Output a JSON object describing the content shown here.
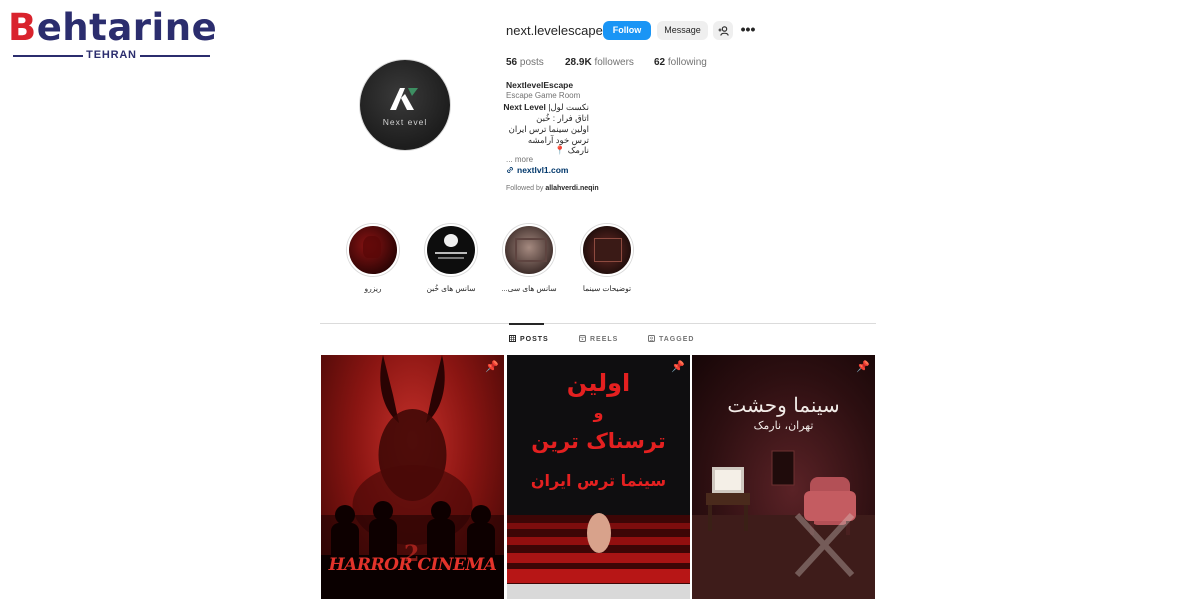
{
  "watermark": {
    "title_first": "B",
    "title_rest": "ehtarine",
    "subtitle": "TEHRAN"
  },
  "profile": {
    "username": "next.levelescape",
    "avatar_text": "Next  evel",
    "buttons": {
      "follow": "Follow",
      "message": "Message",
      "add_user_icon": "add-user-icon",
      "more": "•••"
    },
    "stats": [
      {
        "count": "56",
        "label": "posts"
      },
      {
        "count": "28.9K",
        "label": "followers"
      },
      {
        "count": "62",
        "label": "following"
      }
    ],
    "display_name": "NextlevelEscape",
    "category": "Escape Game Room",
    "bio": {
      "line1_en": "Next Level",
      "line1_fa": "نکست لول|",
      "line2": "اتاق فرار : خُبن",
      "line3": "اولین سینما ترس ایران",
      "line4": "ترس خود آرامشه",
      "line5": "نارمک 📍"
    },
    "more": "... more",
    "link": "nextlvl1.com",
    "followed_by_label": "Followed by",
    "followed_by_user": "allahverdi.neqin"
  },
  "highlights": [
    {
      "label": "ریزرو"
    },
    {
      "label": "سانس های خُبن"
    },
    {
      "label": "سانس های سی..."
    },
    {
      "label": "توضیحات سینما"
    }
  ],
  "tabs": [
    {
      "label": "POSTS",
      "icon": "grid-icon",
      "active": true
    },
    {
      "label": "REELS",
      "icon": "reels-icon",
      "active": false
    },
    {
      "label": "TAGGED",
      "icon": "tagged-icon",
      "active": false
    }
  ],
  "posts": [
    {
      "title": "HARROR CINEMA",
      "number": "2",
      "pinned": true
    },
    {
      "line1": "اولین",
      "line2": "و",
      "line3": "ترسناک ترین",
      "line4": "سینما ترس ایران",
      "pinned": true
    },
    {
      "title": "سینما وحشت",
      "subtitle": "تهران، نارمک",
      "pinned": true
    }
  ]
}
